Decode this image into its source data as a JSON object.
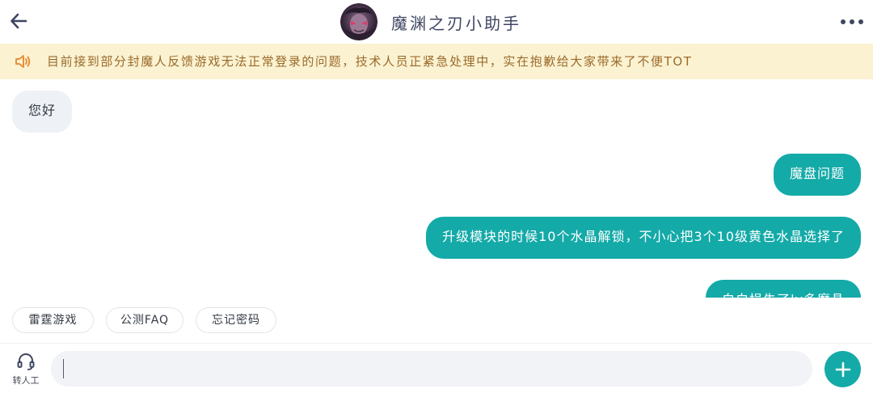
{
  "header": {
    "title": "魔渊之刃小助手",
    "avatar_icon": "demon-avatar"
  },
  "notice": {
    "icon": "speaker-icon",
    "text": "目前接到部分封魔人反馈游戏无法正常登录的问题，技术人员正紧急处理中，实在抱歉给大家带来了不便TOT"
  },
  "messages": [
    {
      "side": "in",
      "text": "您好"
    },
    {
      "side": "out",
      "text": "魔盘问题"
    },
    {
      "side": "out",
      "text": "升级模块的时候10个水晶解锁，不小心把3个10级黄色水晶选择了"
    },
    {
      "side": "out",
      "text": "白白损失了lv多魔晶"
    }
  ],
  "quick_replies": [
    "雷霆游戏",
    "公测FAQ",
    "忘记密码"
  ],
  "input": {
    "agent_label": "转人工",
    "value": "",
    "placeholder": ""
  },
  "colors": {
    "accent": "#14aaa8",
    "notice_bg": "#fbf2d1",
    "notice_text": "#9a6a2c",
    "incoming_bubble": "#eef1f6",
    "title_text": "#3f4662"
  }
}
